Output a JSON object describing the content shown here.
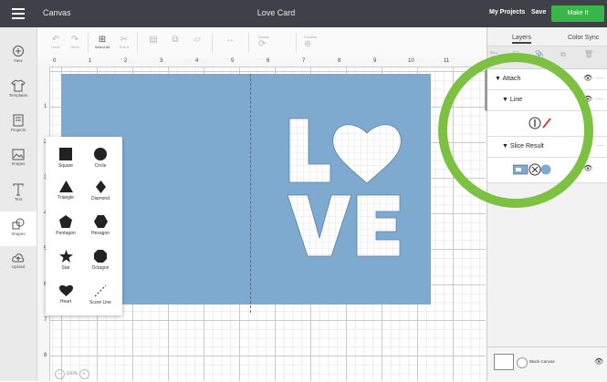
{
  "topbar": {
    "app_title": "Canvas",
    "project_name": "Love Card",
    "my_projects": "My Projects",
    "save": "Save",
    "make_it": "Make It"
  },
  "leftnav": [
    "New",
    "Templates",
    "Projects",
    "Images",
    "Text",
    "Shapes",
    "Upload"
  ],
  "toolbar": {
    "undo": "Undo",
    "redo": "Redo",
    "select_all": "Select All",
    "edit": "Edit ▾",
    "rotate": "Rotate",
    "position": "Position"
  },
  "ruler": {
    "h": [
      "0",
      "1",
      "2",
      "3",
      "4",
      "5",
      "6",
      "7",
      "8",
      "9",
      "10",
      "11"
    ],
    "v": [
      "1",
      "2",
      "3",
      "4",
      "5",
      "6",
      "7",
      "8"
    ]
  },
  "shapes_panel": [
    "Square",
    "Circle",
    "Triangle",
    "Diamond",
    "Pentagon",
    "Hexagon",
    "Star",
    "Octagon",
    "Heart",
    "Score Line"
  ],
  "canvas": {
    "card_color": "#7faacf",
    "word_top": "L",
    "word_bottom": "VE"
  },
  "zoom": {
    "level": "100%"
  },
  "right_panel": {
    "tabs": [
      "Layers",
      "Color Sync"
    ],
    "tools": [
      "Slice",
      "Weld",
      "Attach",
      "Flatten",
      "Duplicate",
      "Delete"
    ],
    "layers": {
      "attach": "Attach",
      "line": "Line",
      "slice_result": "Slice Result"
    },
    "blank_canvas": "Blank Canvas"
  },
  "colors": {
    "accent_green": "#39b54a",
    "highlight_circle": "#7dc142",
    "line_red": "#e0262b"
  }
}
